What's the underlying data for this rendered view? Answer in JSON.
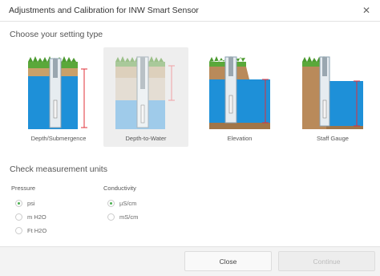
{
  "dialog": {
    "title": "Adjustments and Calibration for INW Smart Sensor",
    "close_glyph": "✕"
  },
  "setting_type": {
    "heading": "Choose your setting type",
    "selected": "Depth-to-Water",
    "options": [
      {
        "label": "Depth/Submergence",
        "icon": "depth-submergence-illustration"
      },
      {
        "label": "Depth-to-Water",
        "icon": "depth-to-water-illustration"
      },
      {
        "label": "Elevation",
        "icon": "elevation-illustration"
      },
      {
        "label": "Staff Gauge",
        "icon": "staff-gauge-illustration"
      }
    ]
  },
  "units": {
    "heading": "Check measurement units",
    "pressure": {
      "label": "Pressure",
      "selected": "psi",
      "options": [
        "psi",
        "m H2O",
        "Ft H2O"
      ]
    },
    "conductivity": {
      "label": "Conductivity",
      "selected": "µS/cm",
      "options": [
        "µS/cm",
        "mS/cm"
      ]
    }
  },
  "footer": {
    "close_label": "Close",
    "continue_label": "Continue"
  },
  "colors": {
    "accent": "#4caf50",
    "water": "#1e90d8",
    "soil": "#b98a5a",
    "grass": "#5aa83a",
    "measure": "#e0303a"
  }
}
